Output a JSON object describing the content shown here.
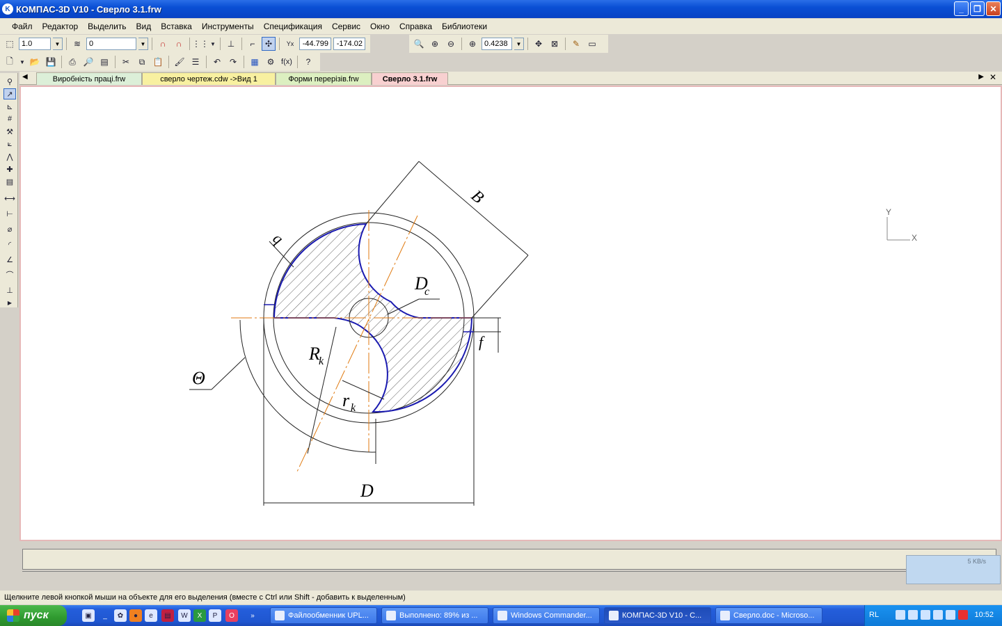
{
  "window": {
    "title": "КОМПАС-3D V10 - Сверло 3.1.frw",
    "app_icon": "K",
    "buttons": {
      "min": "_",
      "max": "❐",
      "close": "✕"
    }
  },
  "menu": [
    "Файл",
    "Редактор",
    "Выделить",
    "Вид",
    "Вставка",
    "Инструменты",
    "Спецификация",
    "Сервис",
    "Окно",
    "Справка",
    "Библиотеки"
  ],
  "toolbar": {
    "scale": "1.0",
    "layer": "0",
    "coord_x": "-44.799",
    "coord_y": "-174.02",
    "zoom": "0.4238"
  },
  "doc_tabs": [
    {
      "label": "Виробність праці.frw",
      "color": "#dcefd8"
    },
    {
      "label": "сверло чертеж.cdw ->Вид 1",
      "color": "#f8f0a0"
    },
    {
      "label": "Форми перерізів.frw",
      "color": "#dcefc0"
    },
    {
      "label": "Сверло 3.1.frw",
      "color": "#f8d0d0",
      "active": true
    }
  ],
  "drawing": {
    "labels": {
      "B": "B",
      "q": "q",
      "Dc_main": "D",
      "Dc_sub": "c",
      "f": "f",
      "Rk_main": "R",
      "Rk_sub": "k",
      "rk_main": "r",
      "rk_sub": "k",
      "theta": "Θ",
      "D": "D"
    },
    "axes": {
      "y": "Y",
      "x": "X"
    }
  },
  "netmon": {
    "speed": "5 KB/s"
  },
  "status": "Щелкните левой кнопкой мыши на объекте для его выделения (вместе с Ctrl или Shift - добавить к выделенным)",
  "taskbar": {
    "start": "пуск",
    "tasks": [
      {
        "label": "Файлообменник UPL..."
      },
      {
        "label": "Выполнено: 89% из ..."
      },
      {
        "label": "Windows Commander..."
      },
      {
        "label": "КОМПАС-3D V10 - С...",
        "active": true
      },
      {
        "label": "Сверло.doc - Microso..."
      }
    ],
    "lang": "RL",
    "clock": "10:52"
  },
  "colors": {
    "contour": "#1a1ab0",
    "axis": "#e07a10",
    "hatch": "#222222"
  }
}
